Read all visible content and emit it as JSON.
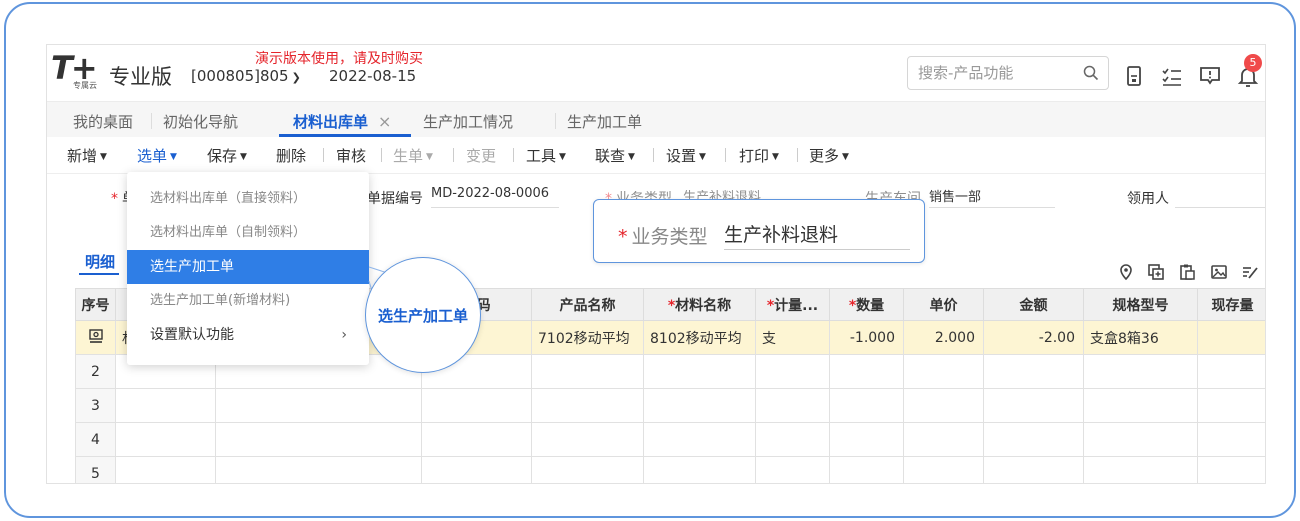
{
  "header": {
    "logo_text": "T+",
    "logo_sub": "专属云",
    "edition": "专业版",
    "account": "[000805]805",
    "date": "2022-08-15",
    "demo_notice": "演示版本使用，请及时购买",
    "search_placeholder": "搜索-产品功能",
    "notification_count": "5",
    "icons": [
      "calculator-icon",
      "task-list-icon",
      "message-icon",
      "bell-icon"
    ]
  },
  "tabs": [
    {
      "label": "我的桌面"
    },
    {
      "label": "初始化导航"
    },
    {
      "label": "材料出库单",
      "active": true,
      "close": "×"
    },
    {
      "label": "生产加工情况"
    },
    {
      "label": "生产加工单"
    }
  ],
  "toolbar": {
    "new": "新增",
    "select": "选单",
    "save": "保存",
    "delete": "删除",
    "audit": "审核",
    "generate": "生单",
    "change": "变更",
    "tools": "工具",
    "linked_query": "联查",
    "settings": "设置",
    "print": "打印",
    "more": "更多"
  },
  "form": {
    "doc_label_partial": "单",
    "doc_no_label": "单据编号",
    "doc_no_value": "MD-2022-08-0006",
    "biz_type_label": "业务类型",
    "biz_type_value": "生产补料退料",
    "workshop_label": "生产车间",
    "workshop_value": "销售一部",
    "receiver_label": "领用人",
    "receiver_value": ""
  },
  "select_menu": {
    "items": [
      "选材料出库单（直接领料）",
      "选材料出库单（自制领料）",
      "选生产加工单",
      "选生产加工单(新增材料)",
      "设置默认功能"
    ],
    "selected_index": 2,
    "submenu_arrow": "›"
  },
  "zoom_callout": {
    "label": "业务类型",
    "value": "生产补料退料"
  },
  "circle_callout": {
    "text": "选生产加工单"
  },
  "detail": {
    "tab_label": "明细",
    "icons": [
      "location-icon",
      "add-row-icon",
      "paste-icon",
      "image-icon",
      "edit-icon"
    ]
  },
  "grid": {
    "columns": [
      "序号",
      "",
      "",
      "编码",
      "产品名称",
      "材料名称",
      "计量...",
      "数量",
      "单价",
      "金额",
      "规格型号",
      "现存量"
    ],
    "required_columns": [
      5,
      6,
      7
    ],
    "rows": [
      {
        "seq": "",
        "c1": "材",
        "c2": "",
        "c3": "",
        "product": "7102移动平均",
        "material": "8102移动平均",
        "unit": "支",
        "qty": "-1.000",
        "price": "2.000",
        "amount": "-2.00",
        "spec": "支盒8箱36",
        "stock": ""
      },
      {
        "seq": "2"
      },
      {
        "seq": "3"
      },
      {
        "seq": "4"
      },
      {
        "seq": "5"
      }
    ]
  }
}
